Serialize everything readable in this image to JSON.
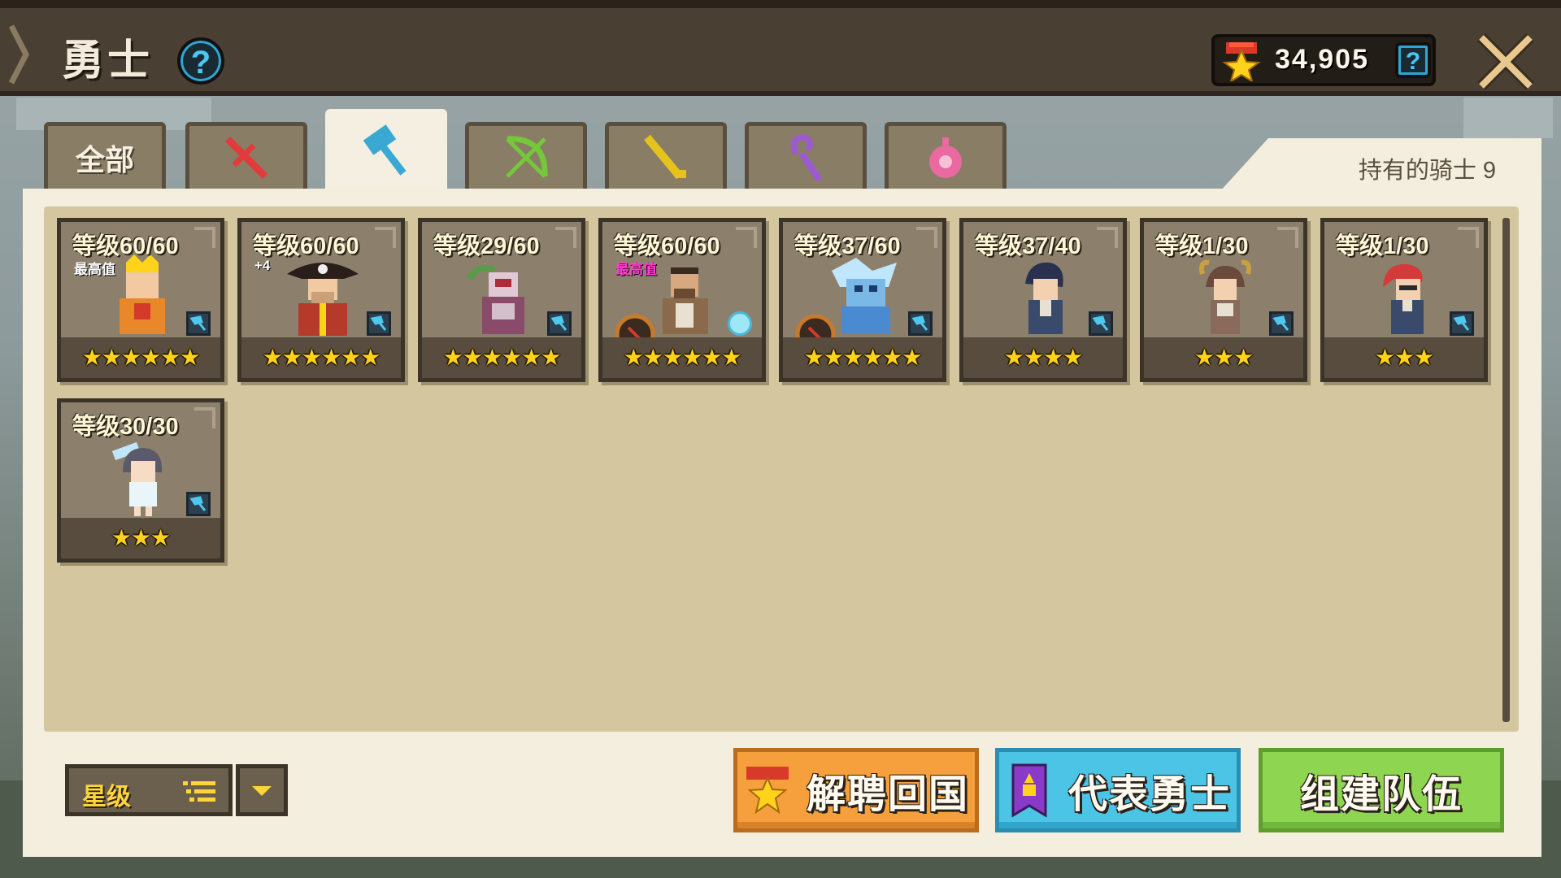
{
  "header": {
    "title": "勇士",
    "help": "?",
    "currency_amount": "34,905",
    "currency_help": "?"
  },
  "tabs": [
    {
      "label": "全部",
      "icon": "all",
      "active": false
    },
    {
      "label": "",
      "icon": "sword-icon",
      "color": "#e23b3b",
      "active": false
    },
    {
      "label": "",
      "icon": "hammer-icon",
      "color": "#39a9d4",
      "active": true
    },
    {
      "label": "",
      "icon": "bow-icon",
      "color": "#74c83a",
      "active": false
    },
    {
      "label": "",
      "icon": "rifle-icon",
      "color": "#e6c21c",
      "active": false
    },
    {
      "label": "",
      "icon": "staff-icon",
      "color": "#9c5ad6",
      "active": false
    },
    {
      "label": "",
      "icon": "orb-icon",
      "color": "#e86aa0",
      "active": false
    }
  ],
  "owned_knights": "持有的骑士 9",
  "knights": [
    {
      "level": "等级60/60",
      "tag": "最高值",
      "tag_color": "white",
      "stars": "★★★★★★",
      "hero_color": "#e89a2a"
    },
    {
      "level": "等级60/60",
      "tag": "+4",
      "tag_color": "white",
      "stars": "★★★★★★",
      "hero_color": "#b53a2a"
    },
    {
      "level": "等级29/60",
      "tag": "",
      "stars": "★★★★★★",
      "hero_color": "#9a5a7a"
    },
    {
      "level": "等级60/60",
      "tag": "最高值",
      "tag_color": "pink",
      "stars": "★★★★★★",
      "hero_color": "#8a6a4a"
    },
    {
      "level": "等级37/60",
      "tag": "",
      "stars": "★★★★★★",
      "hero_color": "#7ab8e8"
    },
    {
      "level": "等级37/40",
      "tag": "",
      "stars": "★★★★",
      "hero_color": "#3a4a6a"
    },
    {
      "level": "等级1/30",
      "tag": "",
      "stars": "★★★",
      "hero_color": "#6a4a3a"
    },
    {
      "level": "等级1/30",
      "tag": "",
      "stars": "★★★",
      "hero_color": "#d43a3a"
    },
    {
      "level": "等级30/30",
      "tag": "",
      "stars": "★★★",
      "hero_color": "#5a5a6a"
    }
  ],
  "sort": {
    "label": "星级"
  },
  "buttons": {
    "dismiss": "解聘回国",
    "representative": "代表勇士",
    "team": "组建队伍"
  }
}
